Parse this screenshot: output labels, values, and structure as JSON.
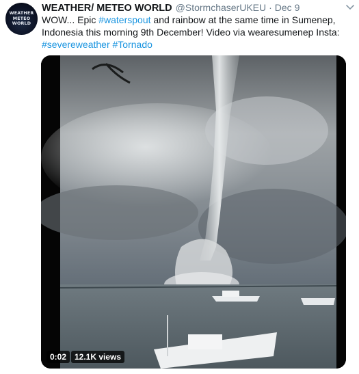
{
  "author": {
    "name": "WEATHER/ METEO WORLD",
    "handle": "@StormchaserUKEU",
    "separator": "·",
    "timestamp": "Dec 9",
    "avatar_lines": [
      "WEATHER",
      "METEO",
      "WORLD"
    ]
  },
  "tweet": {
    "text_part1": "WOW... Epic ",
    "link_waterspout": "#waterspout",
    "text_part2": " and rainbow at the same time in Sumenep, Indonesia this morning 9th December! Video via wearesumenep Insta:",
    "link_severeweather": "#severeweather",
    "link_tornado": "#Tornado"
  },
  "video": {
    "elapsed": "0:02",
    "views": "12.1K views"
  },
  "icons": {
    "caret": "chevron-down-icon",
    "play": "video-player"
  },
  "colors": {
    "link": "#1b95e0",
    "secondary_text": "#657786",
    "primary_text": "#14171a"
  }
}
